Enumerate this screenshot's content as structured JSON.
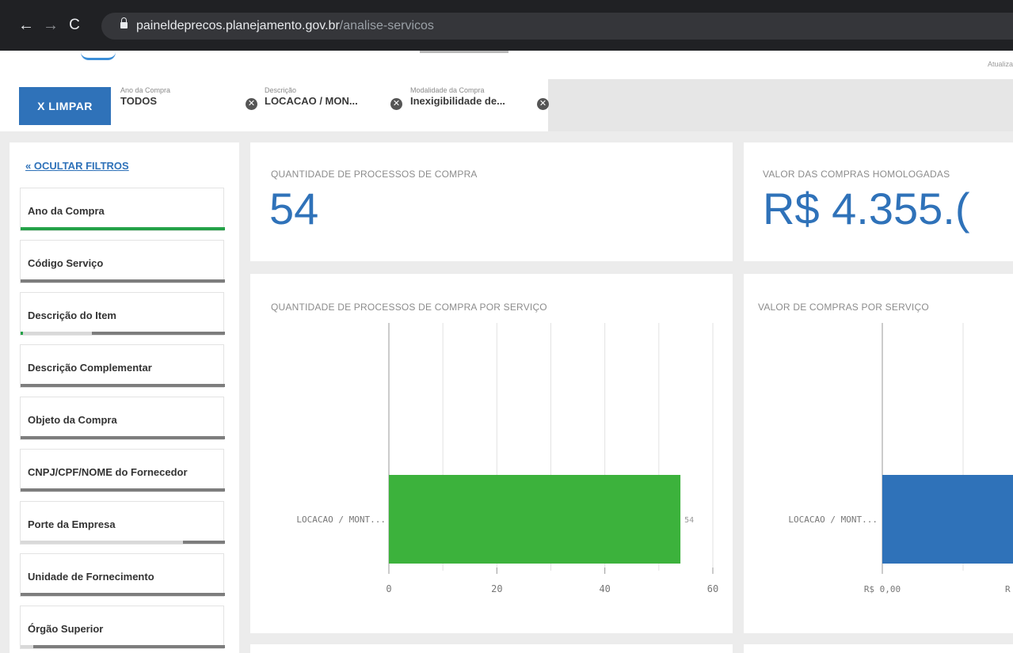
{
  "browser": {
    "nav_back": "←",
    "nav_forward": "→",
    "nav_reload": "C",
    "url_domain": "paineldeprecos.planejamento.gov.br",
    "url_path": "/analise-servicos"
  },
  "header": {
    "updated_text": "Atualiza"
  },
  "filters": {
    "clear_label": "X  LIMPAR",
    "chips": [
      {
        "label": "Ano da Compra",
        "value": "TODOS"
      },
      {
        "label": "Descrição",
        "value": "LOCACAO / MON..."
      },
      {
        "label": "Modalidade da Compra",
        "value": "Inexigibilidade de..."
      }
    ],
    "remove_glyph": "✕"
  },
  "sidebar": {
    "hide_label": "« OCULTAR FILTROS",
    "items": [
      {
        "label": "Ano da Compra"
      },
      {
        "label": "Código Serviço"
      },
      {
        "label": "Descrição do Item"
      },
      {
        "label": "Descrição Complementar"
      },
      {
        "label": "Objeto da Compra"
      },
      {
        "label": "CNPJ/CPF/NOME do Fornecedor"
      },
      {
        "label": "Porte da Empresa"
      },
      {
        "label": "Unidade de Fornecimento"
      },
      {
        "label": "Órgão Superior"
      }
    ]
  },
  "kpis": [
    {
      "title": "QUANTIDADE DE PROCESSOS DE COMPRA",
      "value": "54"
    },
    {
      "title": "VALOR DAS COMPRAS HOMOLOGADAS",
      "value": "R$ 4.355.("
    }
  ],
  "chart_data": [
    {
      "type": "bar",
      "orientation": "horizontal",
      "title": "QUANTIDADE DE PROCESSOS DE COMPRA POR SERVIÇO",
      "categories": [
        "LOCACAO / MONT..."
      ],
      "values": [
        54
      ],
      "value_labels": [
        "54"
      ],
      "xlim": [
        0,
        60
      ],
      "x_ticks": [
        "0",
        "20",
        "40",
        "60"
      ],
      "grid": true,
      "color": "#3cb23c"
    },
    {
      "type": "bar",
      "orientation": "horizontal",
      "title": "VALOR DE COMPRAS POR SERVIÇO",
      "categories": [
        "LOCACAO / MONT..."
      ],
      "x_ticks": [
        "R$ 0,00",
        "R"
      ],
      "grid": true,
      "color": "#2f72b9"
    }
  ]
}
